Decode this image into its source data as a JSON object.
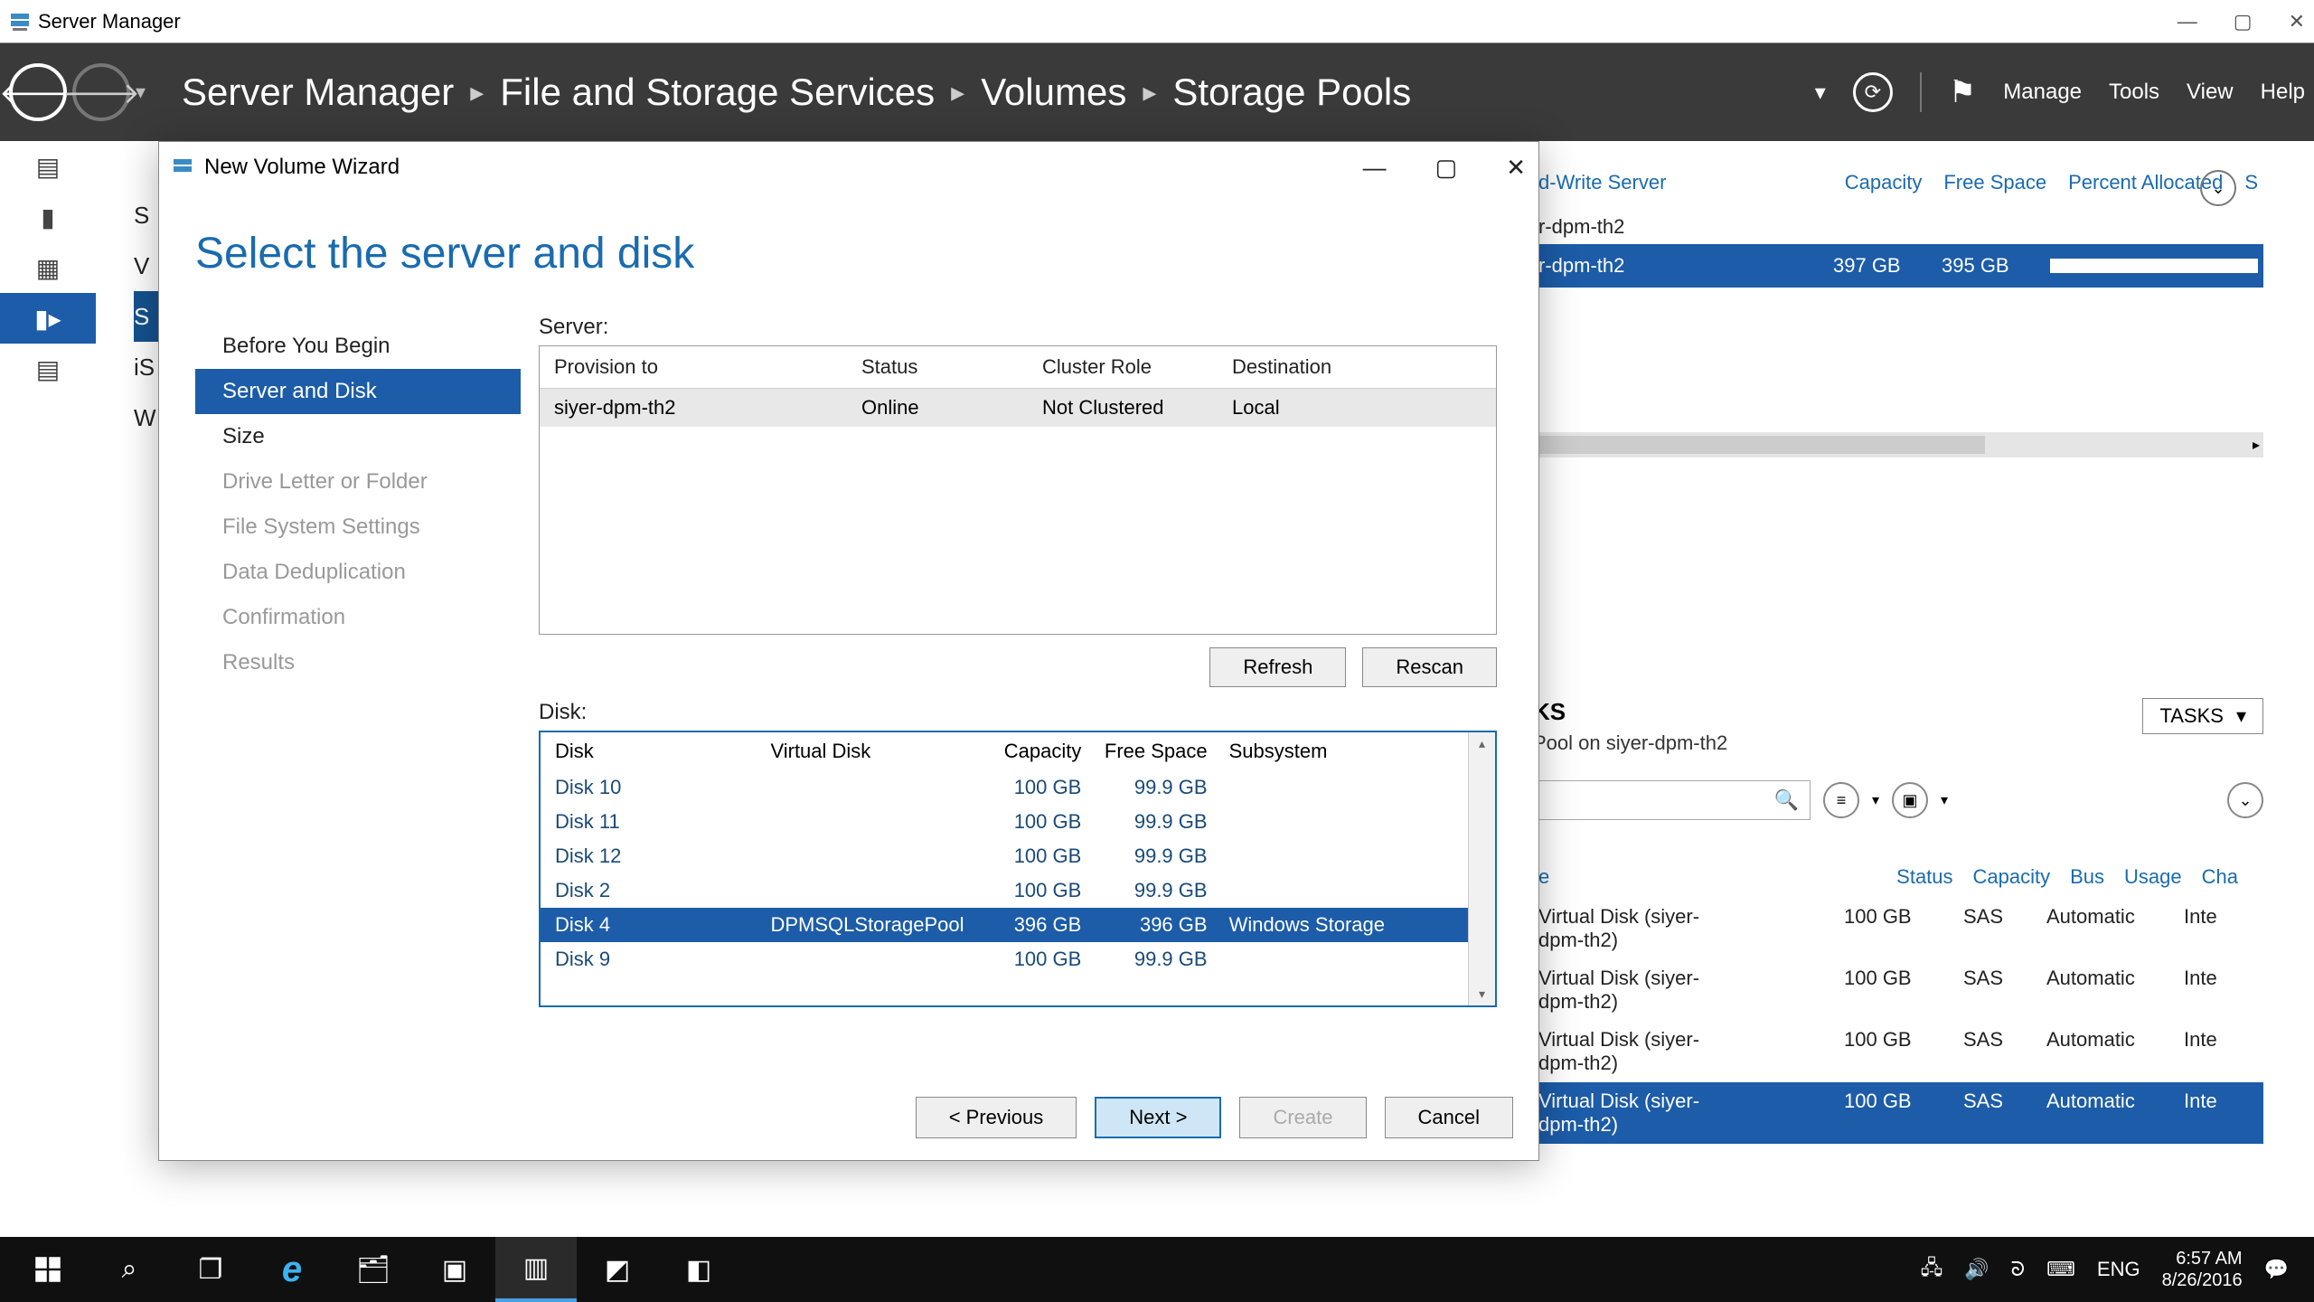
{
  "titlebar": {
    "title": "Server Manager"
  },
  "header": {
    "crumbs": [
      "Server Manager",
      "File and Storage Services",
      "Volumes",
      "Storage Pools"
    ],
    "menu": {
      "manage": "Manage",
      "tools": "Tools",
      "view": "View",
      "help": "Help"
    }
  },
  "leftlist": [
    "S",
    "V",
    "S",
    "iS",
    "W"
  ],
  "bgpanel_top": {
    "cols": {
      "rw": "d-Write Server",
      "cap": "Capacity",
      "free": "Free Space",
      "pct": "Percent Allocated",
      "s": "S"
    },
    "row_plain": "r-dpm-th2",
    "row_sel": {
      "name": "r-dpm-th2",
      "cap": "397 GB",
      "free": "395 GB"
    }
  },
  "bgpanel2": {
    "hdr": "KS",
    "sub": "Pool on siyer-dpm-th2",
    "tasks": "TASKS",
    "cols": {
      "e": "e",
      "status": "Status",
      "cap": "Capacity",
      "bus": "Bus",
      "usage": "Usage",
      "ch": "Cha"
    },
    "rows": [
      {
        "name": "Virtual Disk (siyer-dpm-th2)",
        "status": "",
        "cap": "100 GB",
        "bus": "SAS",
        "usage": "Automatic",
        "ch": "Inte",
        "sel": false
      },
      {
        "name": "Virtual Disk (siyer-dpm-th2)",
        "status": "",
        "cap": "100 GB",
        "bus": "SAS",
        "usage": "Automatic",
        "ch": "Inte",
        "sel": false
      },
      {
        "name": "Virtual Disk (siyer-dpm-th2)",
        "status": "",
        "cap": "100 GB",
        "bus": "SAS",
        "usage": "Automatic",
        "ch": "Inte",
        "sel": false
      },
      {
        "name": "Virtual Disk (siyer-dpm-th2)",
        "status": "",
        "cap": "100 GB",
        "bus": "SAS",
        "usage": "Automatic",
        "ch": "Inte",
        "sel": true
      }
    ]
  },
  "wizard": {
    "title": "New Volume Wizard",
    "heading": "Select the server and disk",
    "steps": [
      {
        "label": "Before You Begin",
        "state": "done"
      },
      {
        "label": "Server and Disk",
        "state": "active"
      },
      {
        "label": "Size",
        "state": "done"
      },
      {
        "label": "Drive Letter or Folder",
        "state": "disabled"
      },
      {
        "label": "File System Settings",
        "state": "disabled"
      },
      {
        "label": "Data Deduplication",
        "state": "disabled"
      },
      {
        "label": "Confirmation",
        "state": "disabled"
      },
      {
        "label": "Results",
        "state": "disabled"
      }
    ],
    "server_label": "Server:",
    "server_cols": {
      "prov": "Provision to",
      "status": "Status",
      "role": "Cluster Role",
      "dest": "Destination"
    },
    "server_rows": [
      {
        "prov": "siyer-dpm-th2",
        "status": "Online",
        "role": "Not Clustered",
        "dest": "Local"
      }
    ],
    "refresh": "Refresh",
    "rescan": "Rescan",
    "disk_label": "Disk:",
    "disk_cols": {
      "disk": "Disk",
      "vdisk": "Virtual Disk",
      "cap": "Capacity",
      "free": "Free Space",
      "sub": "Subsystem"
    },
    "disk_rows": [
      {
        "disk": "Disk 10",
        "vdisk": "",
        "cap": "100 GB",
        "free": "99.9 GB",
        "sub": "",
        "sel": false
      },
      {
        "disk": "Disk 11",
        "vdisk": "",
        "cap": "100 GB",
        "free": "99.9 GB",
        "sub": "",
        "sel": false
      },
      {
        "disk": "Disk 12",
        "vdisk": "",
        "cap": "100 GB",
        "free": "99.9 GB",
        "sub": "",
        "sel": false
      },
      {
        "disk": "Disk 2",
        "vdisk": "",
        "cap": "100 GB",
        "free": "99.9 GB",
        "sub": "",
        "sel": false
      },
      {
        "disk": "Disk 4",
        "vdisk": "DPMSQLStoragePool",
        "cap": "396 GB",
        "free": "396 GB",
        "sub": "Windows Storage",
        "sel": true
      },
      {
        "disk": "Disk 9",
        "vdisk": "",
        "cap": "100 GB",
        "free": "99.9 GB",
        "sub": "",
        "sel": false
      }
    ],
    "buttons": {
      "prev": "< Previous",
      "next": "Next >",
      "create": "Create",
      "cancel": "Cancel"
    }
  },
  "taskbar": {
    "lang": "ENG",
    "time": "6:57 AM",
    "date": "8/26/2016"
  }
}
